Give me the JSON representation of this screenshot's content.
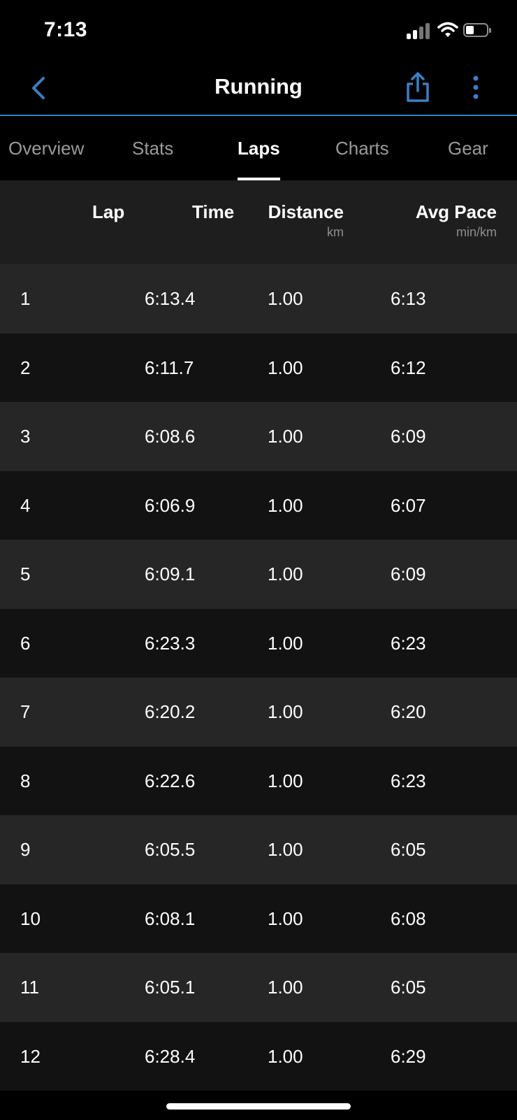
{
  "status_bar": {
    "time": "7:13"
  },
  "nav": {
    "title": "Running"
  },
  "tabs": [
    {
      "label": "Overview"
    },
    {
      "label": "Stats"
    },
    {
      "label": "Laps"
    },
    {
      "label": "Charts"
    },
    {
      "label": "Gear"
    }
  ],
  "active_tab": "Laps",
  "table": {
    "columns": [
      {
        "label": "Lap",
        "unit": ""
      },
      {
        "label": "Time",
        "unit": ""
      },
      {
        "label": "Distance",
        "unit": "km"
      },
      {
        "label": "Avg Pace",
        "unit": "min/km"
      }
    ],
    "rows": [
      {
        "lap": "1",
        "time": "6:13.4",
        "distance": "1.00",
        "pace": "6:13"
      },
      {
        "lap": "2",
        "time": "6:11.7",
        "distance": "1.00",
        "pace": "6:12"
      },
      {
        "lap": "3",
        "time": "6:08.6",
        "distance": "1.00",
        "pace": "6:09"
      },
      {
        "lap": "4",
        "time": "6:06.9",
        "distance": "1.00",
        "pace": "6:07"
      },
      {
        "lap": "5",
        "time": "6:09.1",
        "distance": "1.00",
        "pace": "6:09"
      },
      {
        "lap": "6",
        "time": "6:23.3",
        "distance": "1.00",
        "pace": "6:23"
      },
      {
        "lap": "7",
        "time": "6:20.2",
        "distance": "1.00",
        "pace": "6:20"
      },
      {
        "lap": "8",
        "time": "6:22.6",
        "distance": "1.00",
        "pace": "6:23"
      },
      {
        "lap": "9",
        "time": "6:05.5",
        "distance": "1.00",
        "pace": "6:05"
      },
      {
        "lap": "10",
        "time": "6:08.1",
        "distance": "1.00",
        "pace": "6:08"
      },
      {
        "lap": "11",
        "time": "6:05.1",
        "distance": "1.00",
        "pace": "6:05"
      },
      {
        "lap": "12",
        "time": "6:28.4",
        "distance": "1.00",
        "pace": "6:29"
      }
    ]
  },
  "colors": {
    "accent": "#3d7fc4",
    "background": "#000000",
    "row_light": "#262626",
    "row_dark": "#121212",
    "header_bg": "#1e1e1e",
    "tab_inactive": "#9a9a9a"
  },
  "icons": {
    "back": "chevron-left-icon",
    "share": "share-icon",
    "more": "more-vertical-icon",
    "signal": "cellular-signal-icon",
    "wifi": "wifi-icon",
    "battery": "battery-icon"
  }
}
